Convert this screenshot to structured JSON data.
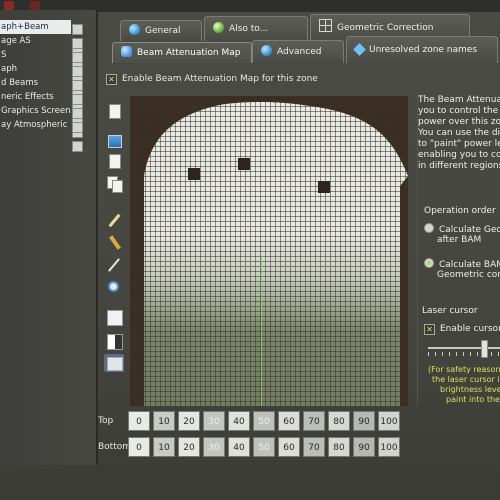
{
  "tree": {
    "items": [
      {
        "label": "aph+Beam",
        "selected": true
      },
      {
        "label": "age AS",
        "selected": false
      },
      {
        "label": "S",
        "selected": false
      },
      {
        "label": "aph",
        "selected": false
      },
      {
        "label": "d Beams",
        "selected": false
      },
      {
        "label": "neric Effects",
        "selected": false
      },
      {
        "label": "Graphics Screen",
        "selected": false
      },
      {
        "label": "ay Atmospheric",
        "selected": false
      }
    ]
  },
  "tabs_row1": [
    {
      "label": "General",
      "icon": "globe-icon"
    },
    {
      "label": "Also to...",
      "icon": "green-globe-icon"
    },
    {
      "label": "Geometric Correction",
      "icon": "grid-icon"
    }
  ],
  "tabs_row2": [
    {
      "label": "Beam Attenuation Map",
      "icon": "beam-map-icon",
      "active": true
    },
    {
      "label": "Advanced",
      "icon": "advanced-icon"
    },
    {
      "label": "Unresolved zone names",
      "icon": "diamond-icon"
    }
  ],
  "enable_bam": {
    "label": "Enable Beam Attenuation Map for this zone",
    "checked": true
  },
  "description_lines": [
    "The Beam Attenua",
    "you to control the m",
    "power over this zone",
    "You can use the dis",
    "to \"paint\" power leve",
    "enabling you to contr",
    "in different regions."
  ],
  "operation_order": {
    "title": "Operation order",
    "options": [
      {
        "line1": "Calculate Geom",
        "line2": "after BAM",
        "selected": false
      },
      {
        "line1": "Calculate BAM",
        "line2": "Geometric corre",
        "selected": true
      }
    ]
  },
  "laser_cursor": {
    "title": "Laser cursor",
    "enable_label": "Enable cursor",
    "enabled": true,
    "note_lines": [
      "(For safety reasons, c",
      "the laser cursor itself i",
      "brightness level",
      "paint into the"
    ]
  },
  "scale": {
    "top_label": "Top",
    "bottom_label": "Bottom",
    "values": [
      "0",
      "10",
      "20",
      "30",
      "40",
      "50",
      "60",
      "70",
      "80",
      "90",
      "100"
    ]
  },
  "colors": {
    "accent_green": "#7be05d",
    "selected_bg": "#e9ece8",
    "note_yellow": "#d8e25a"
  }
}
